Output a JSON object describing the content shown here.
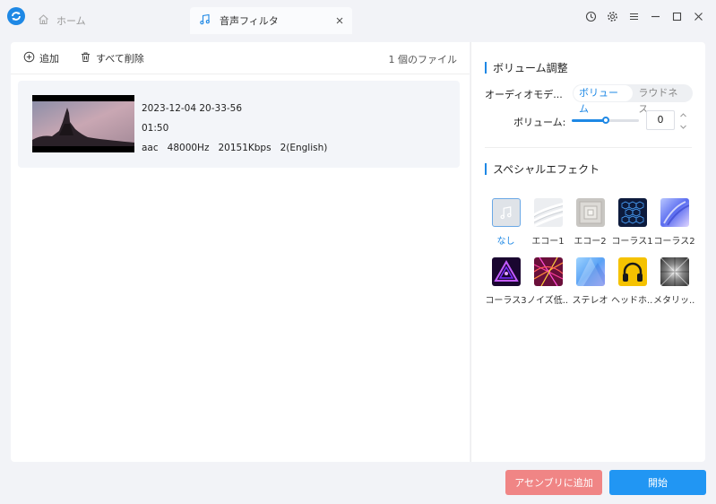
{
  "tabs": {
    "home_label": "ホーム",
    "active_label": "音声フィルタ"
  },
  "toolbar": {
    "add_label": "追加",
    "clear_label": "すべて削除",
    "file_count": "1 個のファイル"
  },
  "file": {
    "name": "2023-12-04 20-33-56",
    "duration": "01:50",
    "audio_info": "aac   48000Hz   20151Kbps   2(English)"
  },
  "volume_section": {
    "title": "ボリューム調整",
    "mode_label": "オーディオモデ...",
    "mode_options": [
      "ボリューム",
      "ラウドネス"
    ],
    "selected_mode": "ボリューム",
    "volume_label": "ボリューム:",
    "volume_value": "0",
    "volume_level_fraction": 0.5
  },
  "effects_section": {
    "title": "スペシャルエフェクト",
    "items": [
      {
        "label": "なし",
        "icon": "music-note-icon",
        "selected": true
      },
      {
        "label": "エコー1",
        "icon": "echo1-icon"
      },
      {
        "label": "エコー2",
        "icon": "echo2-icon"
      },
      {
        "label": "コーラス1",
        "icon": "chorus1-icon"
      },
      {
        "label": "コーラス2",
        "icon": "chorus2-icon"
      },
      {
        "label": "コーラス3",
        "icon": "chorus3-icon"
      },
      {
        "label": "ノイズ低...",
        "icon": "noise-reduction-icon"
      },
      {
        "label": "ステレオ",
        "icon": "stereo-icon"
      },
      {
        "label": "ヘッドホ...",
        "icon": "headphone-icon"
      },
      {
        "label": "メタリッ...",
        "icon": "metallic-icon"
      }
    ]
  },
  "buttons": {
    "assembly_label": "アセンブリに追加",
    "start_label": "開始"
  },
  "colors": {
    "accent": "#1e88e5",
    "start_button": "#2196f3",
    "assembly_button": "#f08585"
  }
}
